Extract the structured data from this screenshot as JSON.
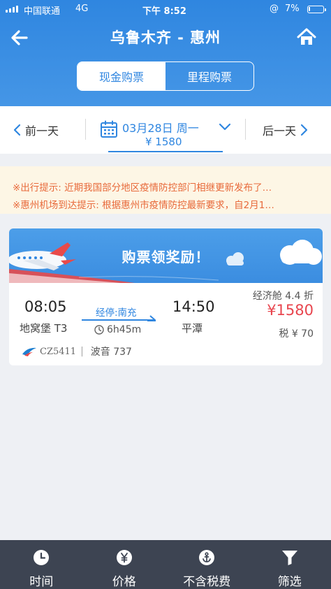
{
  "status_bar": {
    "carrier": "中国联通",
    "network": "4G",
    "time": "下午 8:52",
    "battery": "7%"
  },
  "nav": {
    "title": "乌鲁木齐 - 惠州",
    "back_icon": "back-arrow-icon",
    "home_icon": "home-icon"
  },
  "segment": {
    "tabs": [
      "现金购票",
      "里程购票"
    ],
    "active_index": 0
  },
  "date_bar": {
    "prev_label": "前一天",
    "next_label": "后一天",
    "date": "03月28日 周一",
    "price": "¥ 1580"
  },
  "notices": [
    "※出行提示: 近期我国部分地区疫情防控部门相继更新发布了…",
    "※惠州机场到达提示: 根据惠州市疫情防控最新要求，自2月1…"
  ],
  "banner": {
    "title": "购票领奖励！"
  },
  "flight": {
    "dep_time": "08:05",
    "dep_airport": "地窝堡 T3",
    "stop": "经停:南充",
    "duration": "6h45m",
    "arr_time": "14:50",
    "arr_airport": "平潭",
    "cabin": "经济舱 4.4 折",
    "price": "¥1580",
    "tax": "税 ¥ 70",
    "flight_no": "CZ5411",
    "aircraft": "波音 737"
  },
  "tabbar": {
    "tabs": [
      {
        "label": "时间",
        "icon": "clock-icon"
      },
      {
        "label": "价格",
        "icon": "yen-icon"
      },
      {
        "label": "不含税费",
        "icon": "anchor-icon"
      },
      {
        "label": "筛选",
        "icon": "filter-icon"
      }
    ]
  },
  "colors": {
    "primary": "#2f86e0",
    "price_red": "#e8454e",
    "notice_text": "#e8693a",
    "tabbar_bg": "#3d4452"
  }
}
